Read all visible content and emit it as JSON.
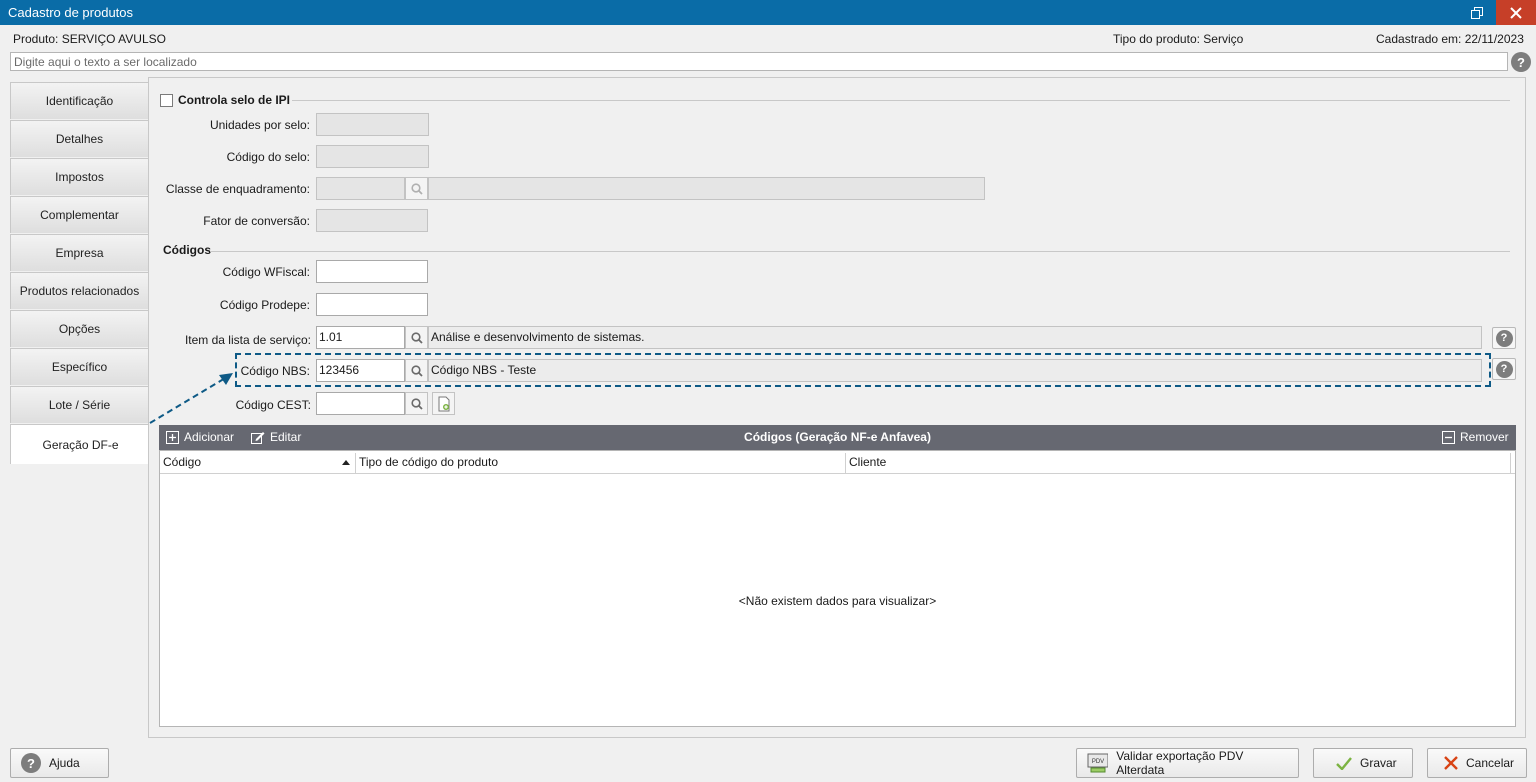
{
  "window": {
    "title": "Cadastro de produtos"
  },
  "info": {
    "produto": "Produto: SERVIÇO AVULSO",
    "tipo": "Tipo do produto: Serviço",
    "cadastrado": "Cadastrado em: 22/11/2023"
  },
  "search": {
    "placeholder": "Digite aqui o texto a ser localizado"
  },
  "tabs": [
    "Identificação",
    "Detalhes",
    "Impostos",
    "Complementar",
    "Empresa",
    "Produtos relacionados",
    "Opções",
    "Específico",
    "Lote / Série",
    "Geração DF-e"
  ],
  "ipi": {
    "checkbox_label": "Controla selo de IPI",
    "unidades_label": "Unidades por selo:",
    "codigo_selo_label": "Código do selo:",
    "classe_label": "Classe de enquadramento:",
    "fator_label": "Fator de conversão:"
  },
  "codigos": {
    "section_title": "Códigos",
    "wfiscal_label": "Código WFiscal:",
    "prodepe_label": "Código Prodepe:",
    "item_lista_label": "Item da lista de serviço:",
    "item_lista_value": "1.01",
    "item_lista_desc": "Análise e desenvolvimento de sistemas.",
    "nbs_label": "Código NBS:",
    "nbs_value": "123456",
    "nbs_desc": "Código NBS - Teste",
    "cest_label": "Código CEST:"
  },
  "grid": {
    "title": "Códigos (Geração NF-e Anfavea)",
    "add_label": "Adicionar",
    "edit_label": "Editar",
    "remove_label": "Remover",
    "columns": [
      "Código",
      "Tipo de código do produto",
      "Cliente"
    ],
    "empty_text": "<Não existem dados para visualizar>"
  },
  "footer": {
    "help_label": "Ajuda",
    "pdv_badge": "PDV",
    "validate_label": "Validar exportação PDV Alterdata",
    "save_label": "Gravar",
    "cancel_label": "Cancelar"
  },
  "colors": {
    "titlebar": "#0a6ca7",
    "close": "#c63f28",
    "highlight": "#0e5a86",
    "grid_header": "#666871"
  }
}
